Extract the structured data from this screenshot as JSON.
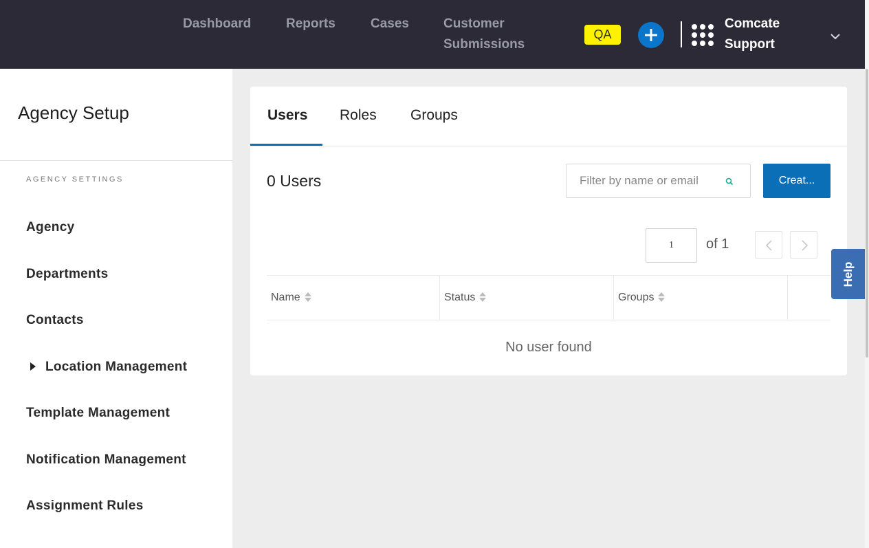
{
  "header": {
    "nav": [
      "Dashboard",
      "Reports",
      "Cases",
      "Customer Submissions"
    ],
    "env_badge": "QA",
    "org_name": "Comcate Support",
    "icons": {
      "add": "plus-circle-icon",
      "apps": "grid-dots-icon",
      "chevron": "chevron-down-icon"
    },
    "colors": {
      "bar": "#2b2a36",
      "badge": "#fff200",
      "accent": "#0b75c9"
    }
  },
  "sidebar": {
    "title": "Agency Setup",
    "section_label": "AGENCY SETTINGS",
    "items": [
      {
        "label": "Agency"
      },
      {
        "label": "Departments"
      },
      {
        "label": "Contacts"
      },
      {
        "label": "Location Management",
        "expandable": true
      },
      {
        "label": "Template Management"
      },
      {
        "label": "Notification Management"
      },
      {
        "label": "Assignment Rules"
      }
    ]
  },
  "main": {
    "tabs": [
      {
        "label": "Users",
        "active": true
      },
      {
        "label": "Roles",
        "active": false
      },
      {
        "label": "Groups",
        "active": false
      }
    ],
    "users_count": "0 Users",
    "filter_placeholder": "Filter by name or email",
    "create_label": "Creat...",
    "pagination": {
      "page": "1",
      "of_label": "of 1"
    },
    "table": {
      "columns": [
        "Name",
        "Status",
        "Groups"
      ],
      "empty_message": "No user found"
    }
  },
  "help_label": "Help"
}
